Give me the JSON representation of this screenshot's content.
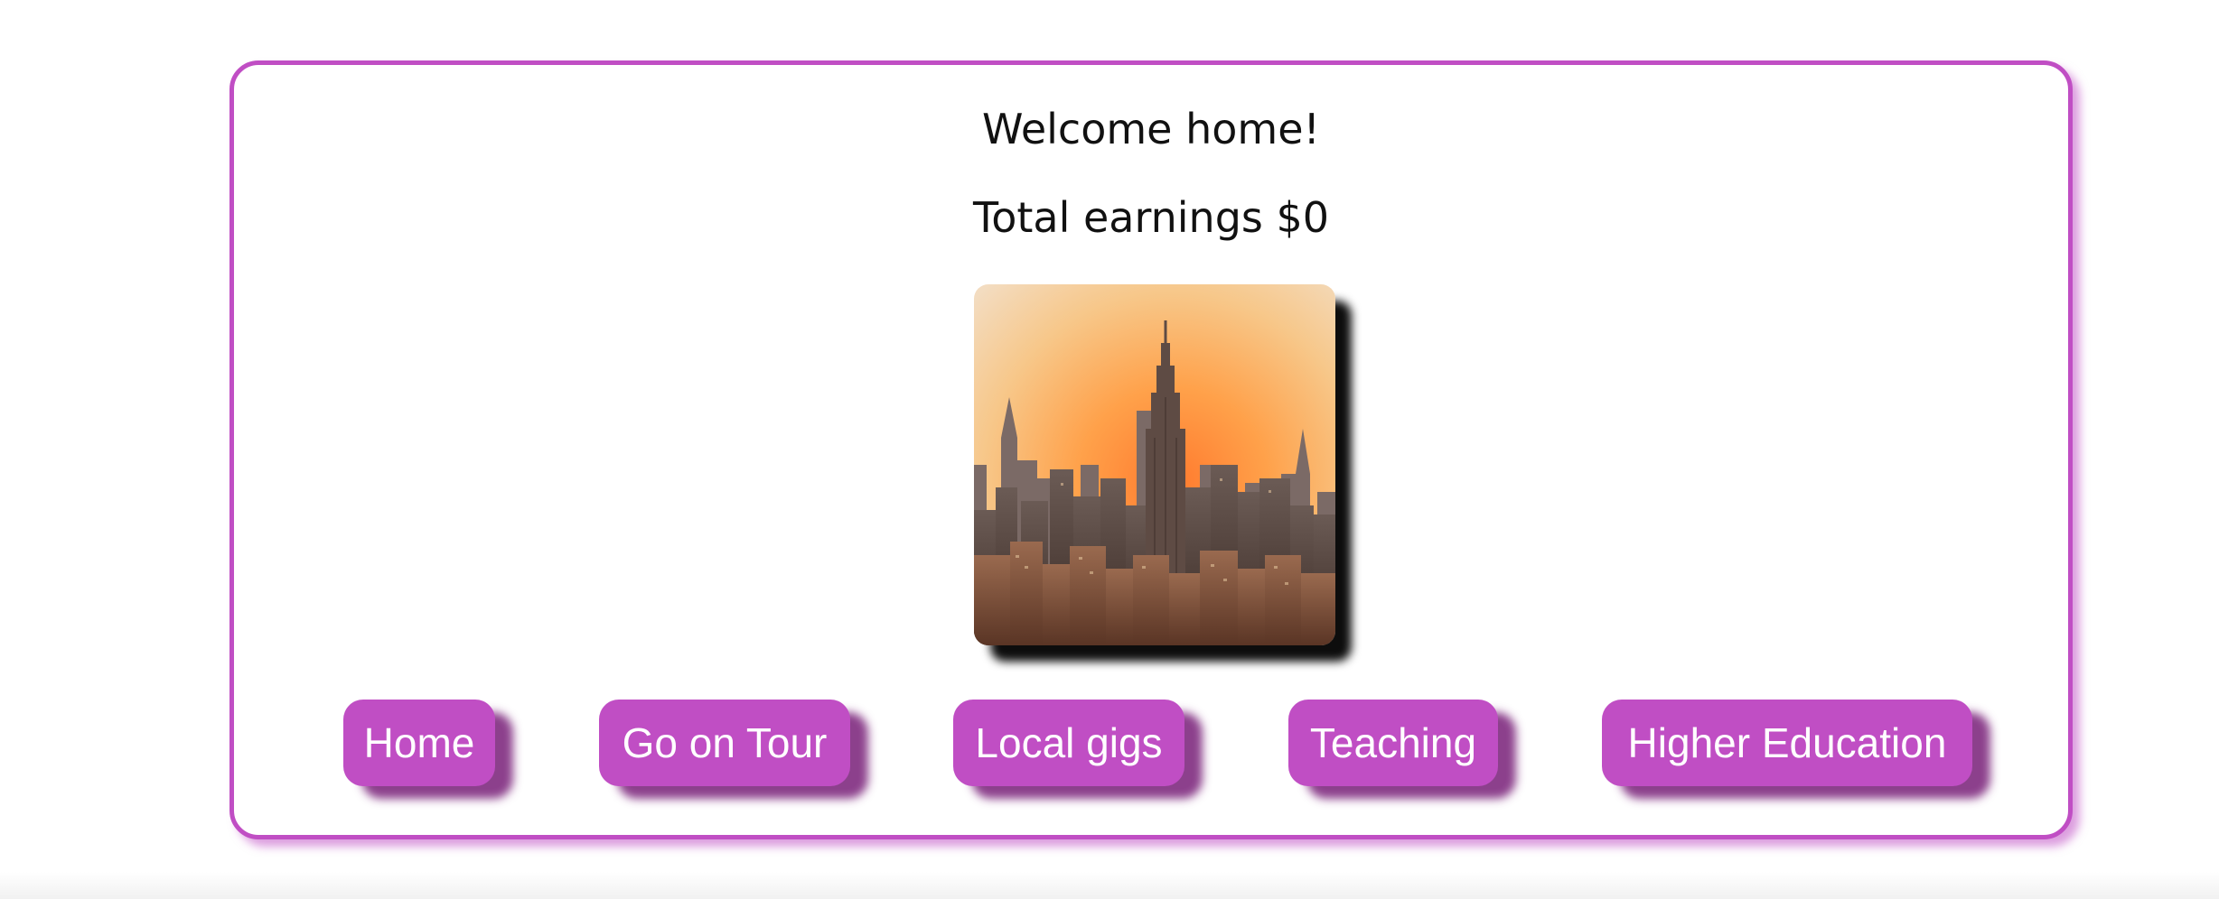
{
  "welcome_text": "Welcome home!",
  "earnings": {
    "label": "Total earnings",
    "value": "$0"
  },
  "image": {
    "subject": "city skyline at sunset"
  },
  "nav": {
    "buttons": [
      {
        "label": "Home"
      },
      {
        "label": "Go on Tour"
      },
      {
        "label": "Local gigs"
      },
      {
        "label": "Teaching"
      },
      {
        "label": "Higher Education"
      }
    ]
  },
  "colors": {
    "accent": "#c04ec4",
    "button_text": "#ffffff",
    "text": "#111111",
    "background": "#ffffff"
  }
}
